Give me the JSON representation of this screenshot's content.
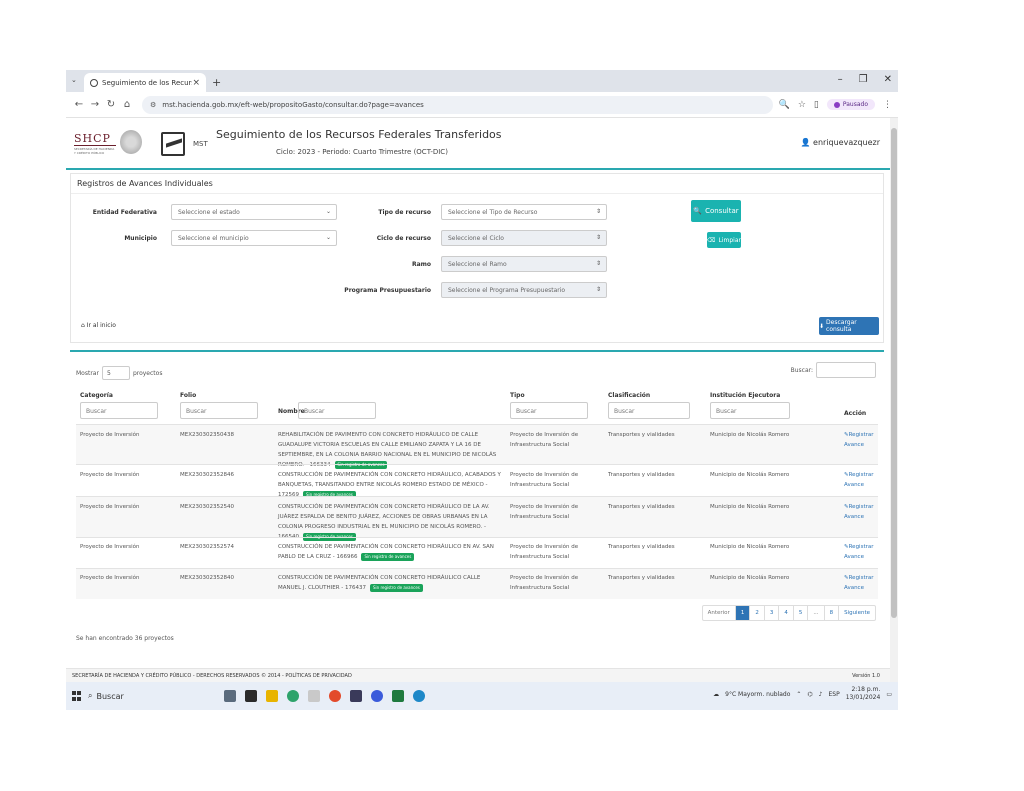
{
  "browser": {
    "tab_title": "Seguimiento de los Recursos F",
    "tab_close": "×",
    "new_tab": "+",
    "tab_list": "⌄",
    "url": "mst.hacienda.gob.mx/eft-web/propositoGasto/consultar.do?page=avances",
    "profile_label": "Pausado",
    "window_controls": [
      "–",
      "❐",
      "✕"
    ]
  },
  "header": {
    "logo_text": "SHCP",
    "logo_sub": "SECRETARÍA DE HACIENDA Y CRÉDITO PÚBLICO",
    "mst_label": "MST",
    "title": "Seguimiento de los Recursos Federales Transferidos",
    "subtitle": "Ciclo: 2023 - Periodo: Cuarto Trimestre (OCT-DIC)",
    "user": "enriquevazquezr"
  },
  "filters": {
    "panel_title": "Registros de Avances Individuales",
    "entidad_label": "Entidad Federativa",
    "entidad_value": "Seleccione el estado",
    "municipio_label": "Municipio",
    "municipio_value": "Seleccione el municipio",
    "tipo_label": "Tipo de recurso",
    "tipo_value": "Seleccione el Tipo de Recurso",
    "ciclo_label": "Ciclo de recurso",
    "ciclo_value": "Seleccione el Ciclo",
    "ramo_label": "Ramo",
    "ramo_value": "Seleccione el Ramo",
    "programa_label": "Programa Presupuestario",
    "programa_value": "Seleccione el Programa Presupuestario",
    "consultar_label": "Consultar",
    "limpiar_label": "Limpiar",
    "home_label": "Ir al inicio",
    "download_label": "Descargar consulta"
  },
  "results": {
    "show_prefix": "Mostrar",
    "show_value": "5",
    "show_suffix": "proyectos",
    "search_label": "Buscar:",
    "columns": {
      "categoria": "Categoría",
      "folio": "Folio",
      "nombre": "Nombre",
      "tipo": "Tipo",
      "clasificacion": "Clasificación",
      "institucion": "Institución Ejecutora",
      "accion": "Acción"
    },
    "filter_placeholder": "Buscar",
    "badge_text": "Sin registro de avances",
    "action_text": "Registrar Avance",
    "rows": [
      {
        "categoria": "Proyecto de Inversión",
        "folio": "MEX230302350438",
        "nombre": "REHABILITACIÓN DE PAVIMENTO CON CONCRETO HIDRÁULICO DE CALLE GUADALUPE VICTORIA ESCUELAS EN CALLE EMILIANO ZAPATA Y LA 16 DE SEPTIEMBRE, EN LA COLONIA BARRIO NACIONAL EN EL MUNICIPIO DE NICOLÁS ROMERO. - 166334",
        "tipo": "Proyecto de Inversión de Infraestructura Social",
        "clasificacion": "Transportes y vialidades",
        "institucion": "Municipio de Nicolás Romero"
      },
      {
        "categoria": "Proyecto de Inversión",
        "folio": "MEX230302352846",
        "nombre": "CONSTRUCCIÓN DE PAVIMENTACIÓN CON CONCRETO HIDRÁULICO, ACABADOS Y BANQUETAS, TRANSITANDO ENTRE NICOLÁS ROMERO ESTADO DE MÉXICO - 172569",
        "tipo": "Proyecto de Inversión de Infraestructura Social",
        "clasificacion": "Transportes y vialidades",
        "institucion": "Municipio de Nicolás Romero"
      },
      {
        "categoria": "Proyecto de Inversión",
        "folio": "MEX230302352540",
        "nombre": "CONSTRUCCIÓN DE PAVIMENTACIÓN CON CONCRETO HIDRÁULICO DE LA AV. JUÁREZ ESPALDA DE BENITO JUÁREZ, ACCIONES DE OBRAS URBANAS EN LA COLONIA PROGRESO INDUSTRIAL EN EL MUNICIPIO DE NICOLÁS ROMERO. - 166540",
        "tipo": "Proyecto de Inversión de Infraestructura Social",
        "clasificacion": "Transportes y vialidades",
        "institucion": "Municipio de Nicolás Romero"
      },
      {
        "categoria": "Proyecto de Inversión",
        "folio": "MEX230302352574",
        "nombre": "CONSTRUCCIÓN DE PAVIMENTACIÓN CON CONCRETO HIDRÁULICO EN AV. SAN PABLO DE LA CRUZ - 166966",
        "tipo": "Proyecto de Inversión de Infraestructura Social",
        "clasificacion": "Transportes y vialidades",
        "institucion": "Municipio de Nicolás Romero"
      },
      {
        "categoria": "Proyecto de Inversión",
        "folio": "MEX230302352840",
        "nombre": "CONSTRUCCIÓN DE PAVIMENTACIÓN CON CONCRETO HIDRÁULICO CALLE MANUEL J. CLOUTHIER - 176437",
        "tipo": "Proyecto de Inversión de Infraestructura Social",
        "clasificacion": "Transportes y vialidades",
        "institucion": "Municipio de Nicolás Romero"
      }
    ],
    "pagination": [
      "Anterior",
      "1",
      "2",
      "3",
      "4",
      "5",
      "...",
      "8",
      "Siguiente"
    ],
    "found_text": "Se han encontrado 36 proyectos"
  },
  "footer": {
    "text": "SECRETARÍA DE HACIENDA Y CRÉDITO PÚBLICO - DERECHOS RESERVADOS © 2014 - POLÍTICAS DE PRIVACIDAD",
    "version": "Versión 1.0"
  },
  "taskbar": {
    "search_label": "Buscar",
    "weather": "9°C Mayorm. nublado",
    "lang": "ESP",
    "time": "2:18 p.m.",
    "date": "13/01/2024"
  },
  "colors": {
    "accent_teal": "#1ab3b0",
    "primary_blue": "#2e74b5",
    "badge_green": "#1aa35a",
    "brand_maroon": "#6b1f2c"
  }
}
